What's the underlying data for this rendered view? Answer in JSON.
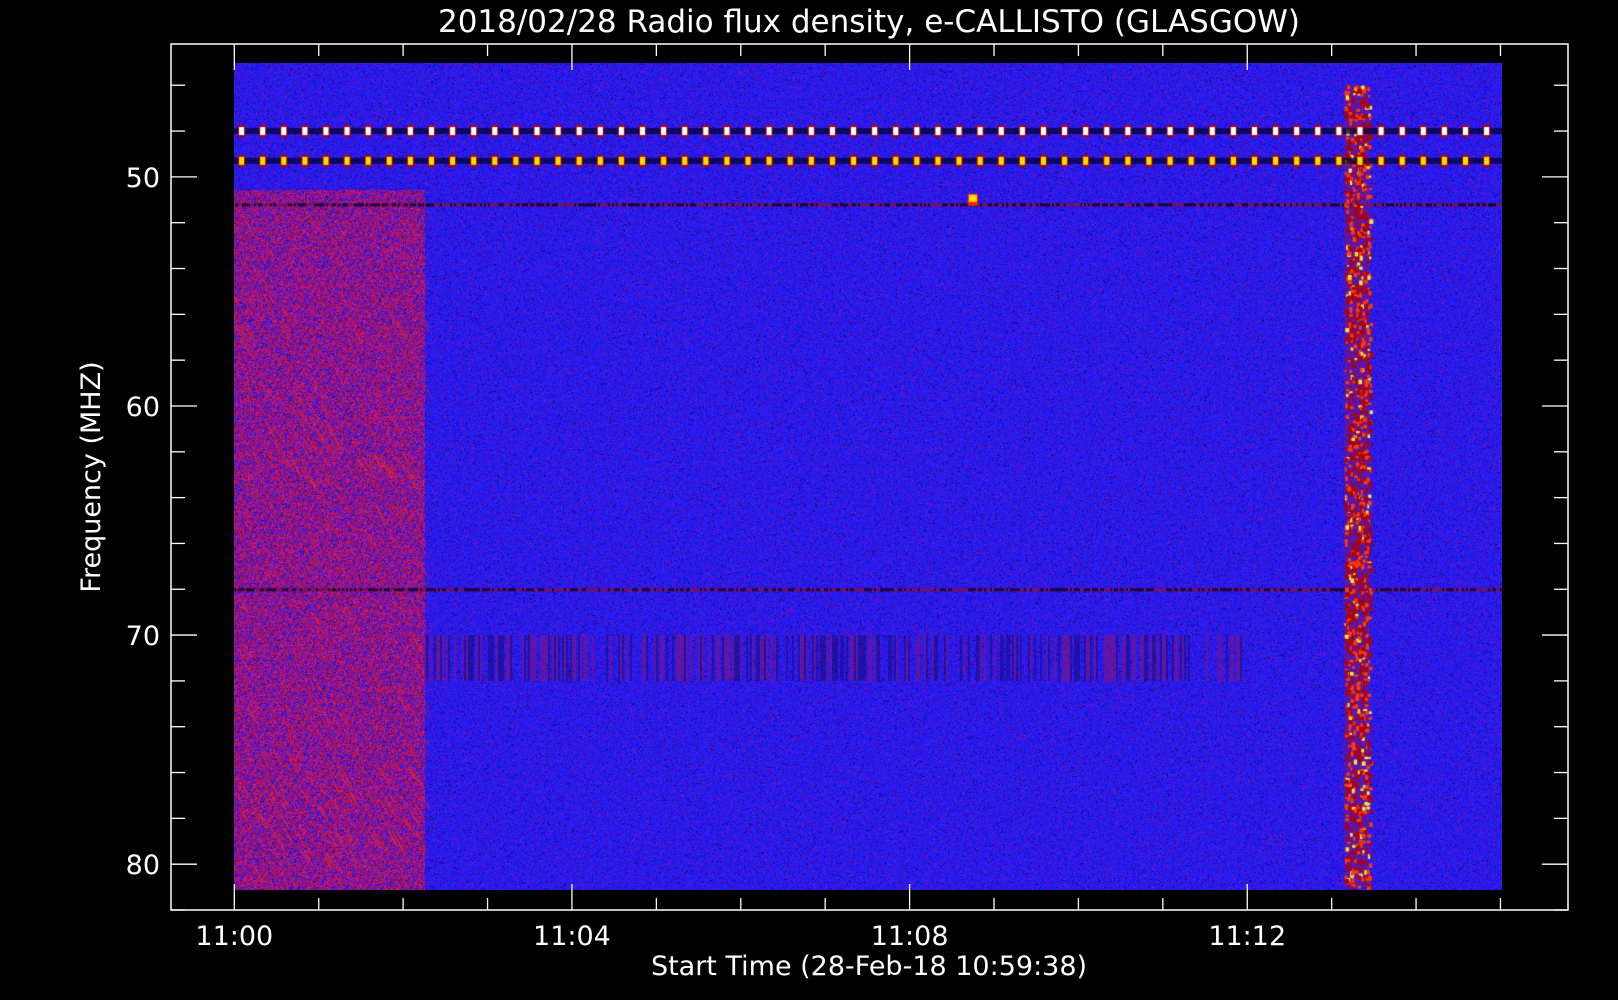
{
  "chart_data": {
    "type": "heatmap",
    "title": "2018/02/28  Radio flux density, e-CALLISTO (GLASGOW)",
    "xlabel": "Start Time (28-Feb-18 10:59:38)",
    "ylabel": "Frequency (MHZ)",
    "x_ticks": [
      "11:00",
      "11:04",
      "11:08",
      "11:12"
    ],
    "y_ticks": [
      "50",
      "60",
      "70",
      "80"
    ],
    "x_range_minutes_after_1100": [
      -0.75,
      15.8
    ],
    "data_time_range_minutes_after_1100": [
      0.0,
      15.0
    ],
    "y_range_mhz": [
      44.2,
      82.0
    ],
    "data_freq_range_mhz": [
      45.0,
      81.0
    ],
    "y_reversed": true,
    "colormap": [
      "#000000",
      "#0000ff",
      "#c00000",
      "#ff3000",
      "#ffe000",
      "#ffffff"
    ],
    "background_color": "#1e1ef0",
    "features": [
      {
        "kind": "elevated_band",
        "t0": 0.0,
        "t1": 2.25,
        "f0": 51.0,
        "f1": 81.0,
        "level": 0.55
      },
      {
        "kind": "burst_column",
        "t0": 13.15,
        "t1": 13.45,
        "f0": 46.0,
        "f1": 81.0,
        "level": 0.8
      },
      {
        "kind": "periodic_interference",
        "freq_mhz": 48.0,
        "period_min": 0.25,
        "level": 0.9
      },
      {
        "kind": "periodic_interference",
        "freq_mhz": 49.3,
        "period_min": 0.25,
        "level": 1.0
      },
      {
        "kind": "interference_line",
        "freq_mhz": 51.2,
        "level": 0.2
      },
      {
        "kind": "interference_line",
        "freq_mhz": 68.0,
        "level": 0.15
      },
      {
        "kind": "striated_band",
        "t0": 2.25,
        "t1": 12.0,
        "f0": 70.0,
        "f1": 72.0,
        "level": 0.4
      },
      {
        "kind": "spot",
        "t": 8.75,
        "freq_mhz": 51.0,
        "level": 1.0
      }
    ]
  }
}
